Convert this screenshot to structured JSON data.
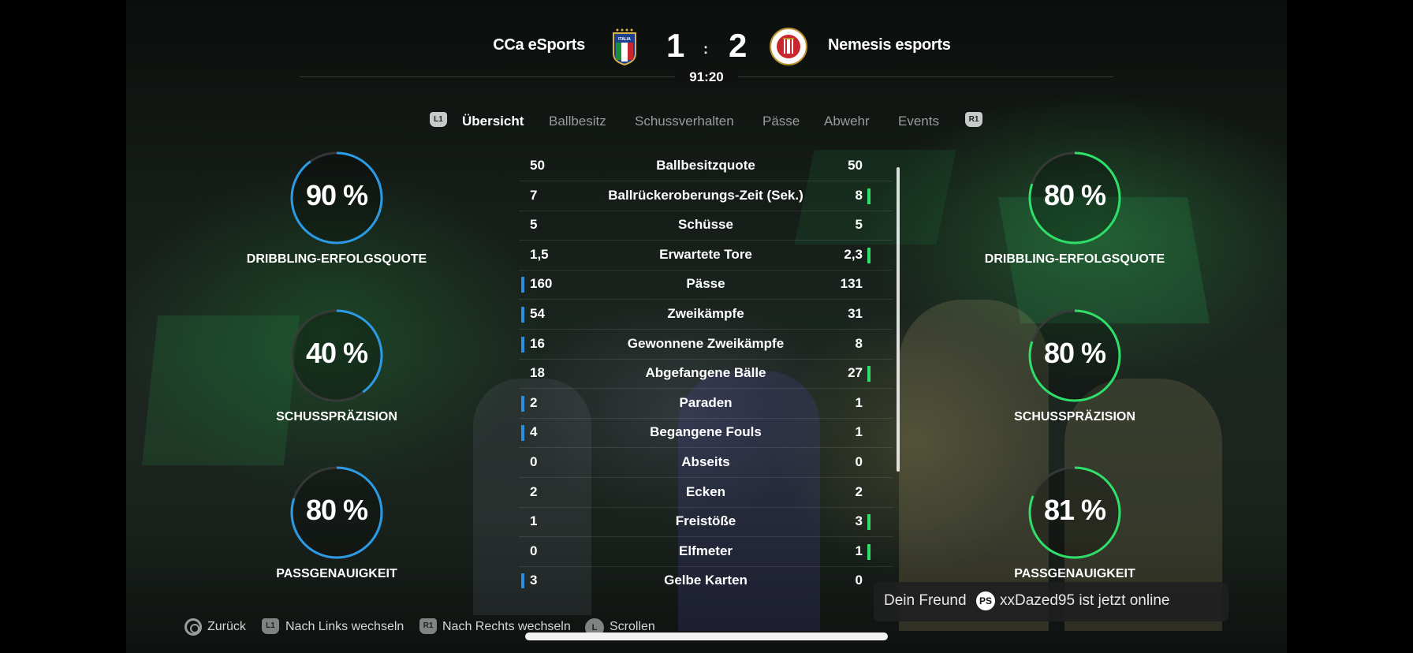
{
  "match": {
    "home_team": "CCa eSports",
    "away_team": "Nemesis esports",
    "home_crest_icon": "italia-crest-icon",
    "home_crest_text": "ITALIA",
    "away_crest_icon": "feyenoord-crest-icon",
    "home_score": "1",
    "away_score": "2",
    "separator": ":",
    "clock": "91:20"
  },
  "tabs": {
    "left_badge": "L1",
    "right_badge": "R1",
    "items": [
      "Übersicht",
      "Ballbesitz",
      "Schussverhalten",
      "Pässe",
      "Abwehr",
      "Events"
    ],
    "active_index": 0
  },
  "gauges": {
    "home": [
      {
        "value": "90 %",
        "fraction": 0.9,
        "label": "DRIBBLING-ERFOLGSQUOTE"
      },
      {
        "value": "40 %",
        "fraction": 0.4,
        "label": "SCHUSSPRÄZISION"
      },
      {
        "value": "80 %",
        "fraction": 0.8,
        "label": "PASSGENAUIGKEIT"
      }
    ],
    "away": [
      {
        "value": "80 %",
        "fraction": 0.8,
        "label": "DRIBBLING-ERFOLGSQUOTE"
      },
      {
        "value": "80 %",
        "fraction": 0.8,
        "label": "SCHUSSPRÄZISION"
      },
      {
        "value": "81 %",
        "fraction": 0.81,
        "label": "PASSGENAUIGKEIT"
      }
    ],
    "home_color": "#2b9be6",
    "away_color": "#2ee06a"
  },
  "stats": [
    {
      "label": "Ballbesitzquote",
      "home": "50",
      "away": "50",
      "lead": "none"
    },
    {
      "label": "Ballrückeroberungs-Zeit (Sek.)",
      "home": "7",
      "away": "8",
      "lead": "away"
    },
    {
      "label": "Schüsse",
      "home": "5",
      "away": "5",
      "lead": "none"
    },
    {
      "label": "Erwartete Tore",
      "home": "1,5",
      "away": "2,3",
      "lead": "away"
    },
    {
      "label": "Pässe",
      "home": "160",
      "away": "131",
      "lead": "home"
    },
    {
      "label": "Zweikämpfe",
      "home": "54",
      "away": "31",
      "lead": "home"
    },
    {
      "label": "Gewonnene Zweikämpfe",
      "home": "16",
      "away": "8",
      "lead": "home"
    },
    {
      "label": "Abgefangene Bälle",
      "home": "18",
      "away": "27",
      "lead": "away"
    },
    {
      "label": "Paraden",
      "home": "2",
      "away": "1",
      "lead": "home"
    },
    {
      "label": "Begangene Fouls",
      "home": "4",
      "away": "1",
      "lead": "home"
    },
    {
      "label": "Abseits",
      "home": "0",
      "away": "0",
      "lead": "none"
    },
    {
      "label": "Ecken",
      "home": "2",
      "away": "2",
      "lead": "none"
    },
    {
      "label": "Freistöße",
      "home": "1",
      "away": "3",
      "lead": "away"
    },
    {
      "label": "Elfmeter",
      "home": "0",
      "away": "1",
      "lead": "away"
    },
    {
      "label": "Gelbe Karten",
      "home": "3",
      "away": "0",
      "lead": "home"
    }
  ],
  "notification": {
    "text_before": "Dein Freund",
    "icon": "playstation-icon",
    "icon_text": "PS",
    "text_after": "xxDazed95 ist jetzt online"
  },
  "footer": {
    "back_label": "Zurück",
    "left_badge": "L1",
    "left_label": "Nach Links wechseln",
    "right_badge": "R1",
    "right_label": "Nach Rechts wechseln",
    "scroll_badge": "L",
    "scroll_label": "Scrollen"
  }
}
